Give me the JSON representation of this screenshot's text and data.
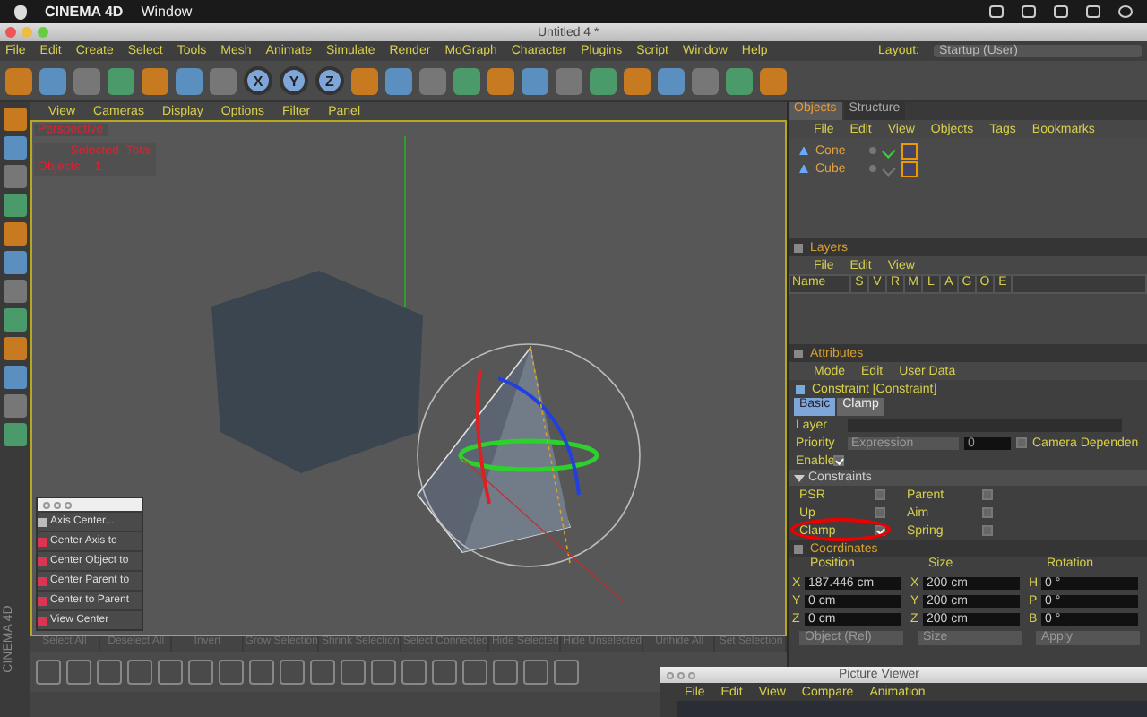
{
  "system_menu": {
    "app": "CINEMA 4D",
    "items": [
      "Window"
    ]
  },
  "window": {
    "title": "Untitled 4 *"
  },
  "menu": [
    "File",
    "Edit",
    "Create",
    "Select",
    "Tools",
    "Mesh",
    "Animate",
    "Simulate",
    "Render",
    "MoGraph",
    "Character",
    "Plugins",
    "Script",
    "Window",
    "Help"
  ],
  "layout": {
    "label": "Layout:",
    "value": "Startup (User)"
  },
  "axis_buttons": [
    {
      "label": "X",
      "selected": true
    },
    {
      "label": "Y",
      "selected": true
    },
    {
      "label": "Z",
      "selected": true
    }
  ],
  "viewport": {
    "menu": [
      "View",
      "Cameras",
      "Display",
      "Options",
      "Filter",
      "Panel"
    ],
    "camera": "Perspective",
    "stats_header": "Selected  Total",
    "stats": [
      {
        "label": "Objects",
        "value": "1"
      }
    ]
  },
  "palette": {
    "items": [
      "Axis Center...",
      "Center Axis to",
      "Center Object to",
      "Center Parent to",
      "Center to Parent",
      "View Center"
    ]
  },
  "selection_bar": [
    "Select All",
    "Deselect All",
    "Invert",
    "Grow Selection",
    "Shrink Selection",
    "Select Connected",
    "Hide Selected",
    "Hide Unselected",
    "Unhide All",
    "Set Selection"
  ],
  "logo": "CINEMA 4D",
  "objects_panel": {
    "tabs": [
      {
        "label": "Objects",
        "selected": true
      },
      {
        "label": "Structure",
        "selected": false
      }
    ],
    "menu": [
      "File",
      "Edit",
      "View",
      "Objects",
      "Tags",
      "Bookmarks"
    ],
    "tree": [
      {
        "name": "Cone",
        "enabled": true
      },
      {
        "name": "Cube",
        "enabled": false
      }
    ]
  },
  "layers": {
    "title": "Layers",
    "menu": [
      "File",
      "Edit",
      "View"
    ],
    "columns": [
      "Name",
      "S",
      "V",
      "R",
      "M",
      "L",
      "A",
      "G",
      "O",
      "E"
    ]
  },
  "attributes": {
    "title": "Attributes",
    "menu": [
      "Mode",
      "Edit",
      "User Data"
    ],
    "object": "Constraint [Constraint]",
    "tabs": [
      {
        "label": "Basic",
        "selected": true
      },
      {
        "label": "Clamp",
        "selected": false
      }
    ],
    "layer_label": "Layer",
    "priority_label": "Priority",
    "priority_value": "Expression",
    "priority_number": "0",
    "camera_dependent": {
      "label": "Camera Dependen",
      "checked": false
    },
    "enable": {
      "label": "Enable",
      "checked": true
    },
    "section": "Constraints",
    "options": [
      {
        "label": "PSR",
        "checked": false,
        "highlighted": false
      },
      {
        "label": "Parent",
        "checked": false,
        "highlighted": false
      },
      {
        "label": "Up",
        "checked": false,
        "highlighted": false
      },
      {
        "label": "Aim",
        "checked": false,
        "highlighted": false
      },
      {
        "label": "Clamp",
        "checked": true,
        "highlighted": true
      },
      {
        "label": "Spring",
        "checked": false,
        "highlighted": false
      }
    ]
  },
  "coordinates": {
    "title": "Coordinates",
    "columns": [
      "Position",
      "Size",
      "Rotation"
    ],
    "rows": [
      [
        {
          "axis": "X",
          "value": "187.446 cm"
        },
        {
          "axis": "X",
          "value": "200 cm"
        },
        {
          "axis": "H",
          "value": "0 °"
        }
      ],
      [
        {
          "axis": "Y",
          "value": "0 cm"
        },
        {
          "axis": "Y",
          "value": "200 cm"
        },
        {
          "axis": "P",
          "value": "0 °"
        }
      ],
      [
        {
          "axis": "Z",
          "value": "0 cm"
        },
        {
          "axis": "Z",
          "value": "200 cm"
        },
        {
          "axis": "B",
          "value": "0 °"
        }
      ]
    ],
    "footer": [
      "Object (Rel)",
      "Size",
      "Apply"
    ]
  },
  "picture_viewer": {
    "title": "Picture Viewer",
    "menu": [
      "File",
      "Edit",
      "View",
      "Compare",
      "Animation"
    ]
  }
}
